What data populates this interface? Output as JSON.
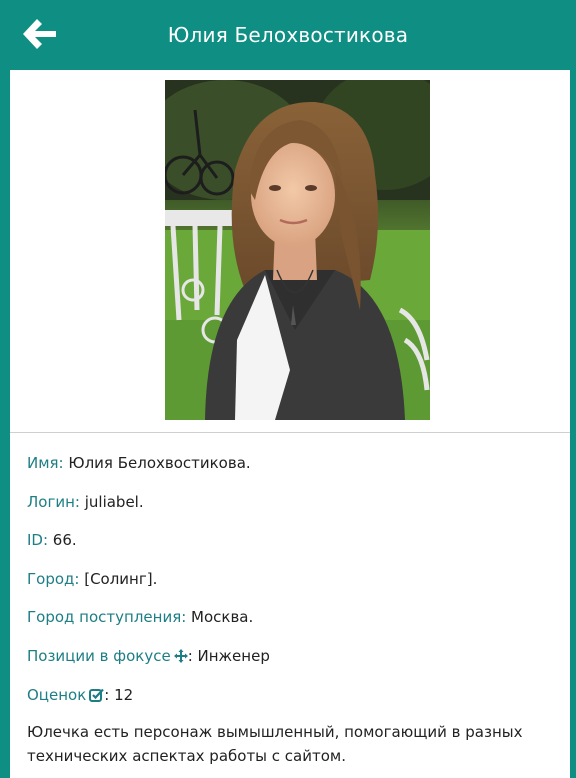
{
  "header": {
    "title": "Юлия Белохвостикова",
    "back_icon": "arrow-left-icon"
  },
  "colors": {
    "accent": "#0f8f83",
    "label": "#1e7e85"
  },
  "profile": {
    "name_label": "Имя:",
    "name_value": " Юлия Белохвостикова.",
    "login_label": "Логин:",
    "login_value": " juliabel.",
    "id_label": "ID:",
    "id_value": " 66.",
    "city_label": "Город:",
    "city_value": " [Солинг].",
    "admission_city_label": "Город поступления:",
    "admission_city_value": " Москва.",
    "focus_label": "Позиции в фокусе",
    "focus_icon": "crosshair-arrows-icon",
    "focus_value": ": Инженер",
    "ratings_label": "Оценок",
    "ratings_icon": "checkbox-checked-icon",
    "ratings_value": ": 12",
    "description": "Юлечка есть персонаж вымышленный, помогающий в разных технических аспектах работы с сайтом."
  }
}
